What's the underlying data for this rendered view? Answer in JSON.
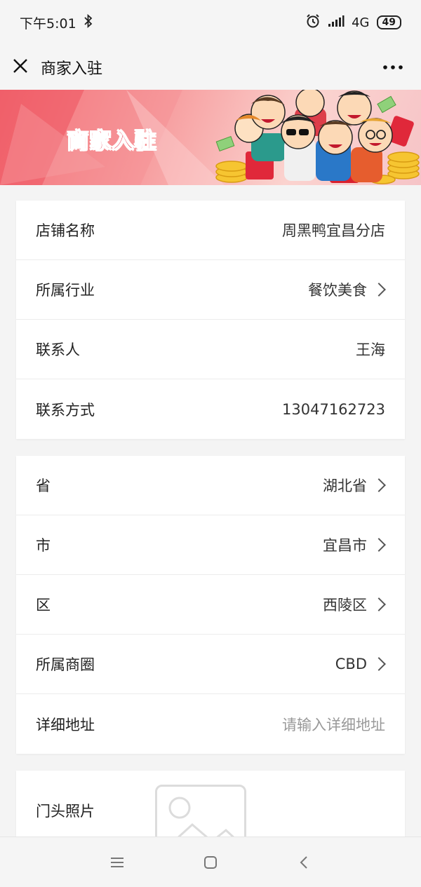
{
  "status_bar": {
    "time": "下午5:01",
    "network": "4G",
    "battery": "49"
  },
  "header": {
    "title": "商家入驻"
  },
  "banner": {
    "title": "商家入驻"
  },
  "store_info": [
    {
      "label": "店铺名称",
      "value": "周黑鸭宜昌分店",
      "chevron": false
    },
    {
      "label": "所属行业",
      "value": "餐饮美食",
      "chevron": true
    },
    {
      "label": "联系人",
      "value": "王海",
      "chevron": false
    },
    {
      "label": "联系方式",
      "value": "13047162723",
      "chevron": false
    }
  ],
  "address_info": [
    {
      "label": "省",
      "value": "湖北省",
      "chevron": true
    },
    {
      "label": "市",
      "value": "宜昌市",
      "chevron": true
    },
    {
      "label": "区",
      "value": "西陵区",
      "chevron": true
    },
    {
      "label": "所属商圈",
      "value": "CBD",
      "chevron": true
    },
    {
      "label": "详细地址",
      "placeholder": "请输入详细地址"
    }
  ],
  "photo": {
    "label": "门头照片"
  },
  "icons": [
    "close-icon",
    "more-icon",
    "bluetooth-icon",
    "alarm-icon",
    "signal-icon",
    "battery-icon",
    "image-placeholder-icon",
    "menu-icon",
    "home-icon",
    "back-icon"
  ]
}
